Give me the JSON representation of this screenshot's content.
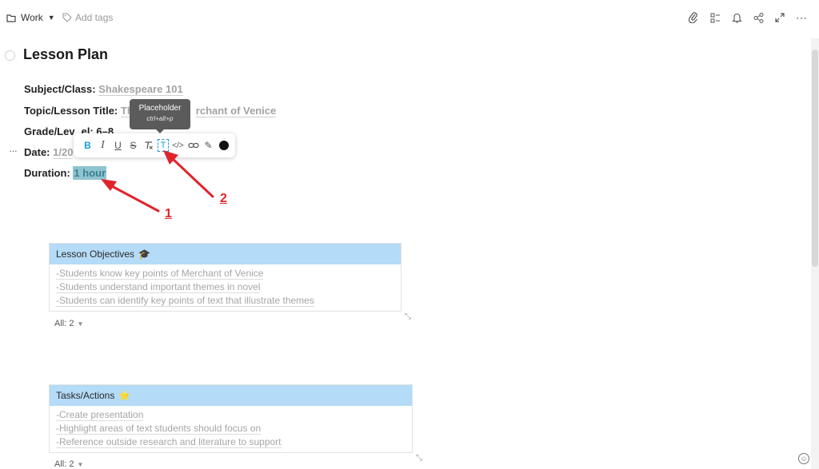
{
  "header": {
    "folder": "Work",
    "add_tags": "Add tags",
    "icons": [
      "paperclip-icon",
      "layout-icon",
      "bell-icon",
      "share-icon",
      "expand-icon",
      "more-icon"
    ]
  },
  "page": {
    "title": "Lesson Plan",
    "fields": [
      {
        "label": "Subject/Class:",
        "value": "Shakespeare 101"
      },
      {
        "label": "Topic/Lesson Title:",
        "value_pre": "Th",
        "value_post": "rchant of Venice"
      },
      {
        "label_pre": "Grade/Lev",
        "label_post": "el: 6–8"
      },
      {
        "label": "Date:",
        "value": "1/20"
      },
      {
        "label": "Duration:",
        "value": "1 hour"
      }
    ]
  },
  "tooltip": {
    "title": "Placeholder",
    "shortcut": "ctrl+alt+p"
  },
  "toolbar": {
    "bold": "B",
    "italic": "I",
    "underline": "U",
    "strike": "S",
    "clear": "T",
    "placeholder": "T",
    "code": "</>",
    "link": "∞",
    "highlight": "✎",
    "color": "#111111"
  },
  "annotations": {
    "one": "1",
    "two": "2",
    "color": "#e0242b"
  },
  "tables": [
    {
      "header": "Lesson Objectives",
      "emoji": "🎓",
      "rows": [
        "-Students know key points of Merchant of Venice",
        "-Students understand important themes in novel",
        "-Students can identify key points of text that illustrate themes"
      ],
      "footer": "All: 2"
    },
    {
      "header": "Tasks/Actions",
      "emoji": "⭐",
      "rows": [
        "-Create presentation",
        "-Highlight areas of text students should focus on",
        "-Reference outside research and literature to support"
      ],
      "footer": "All: 2"
    }
  ],
  "colors": {
    "table_header": "#b4dbf7",
    "accent": "#1a9bd7",
    "selection": "#8fc3cf"
  }
}
